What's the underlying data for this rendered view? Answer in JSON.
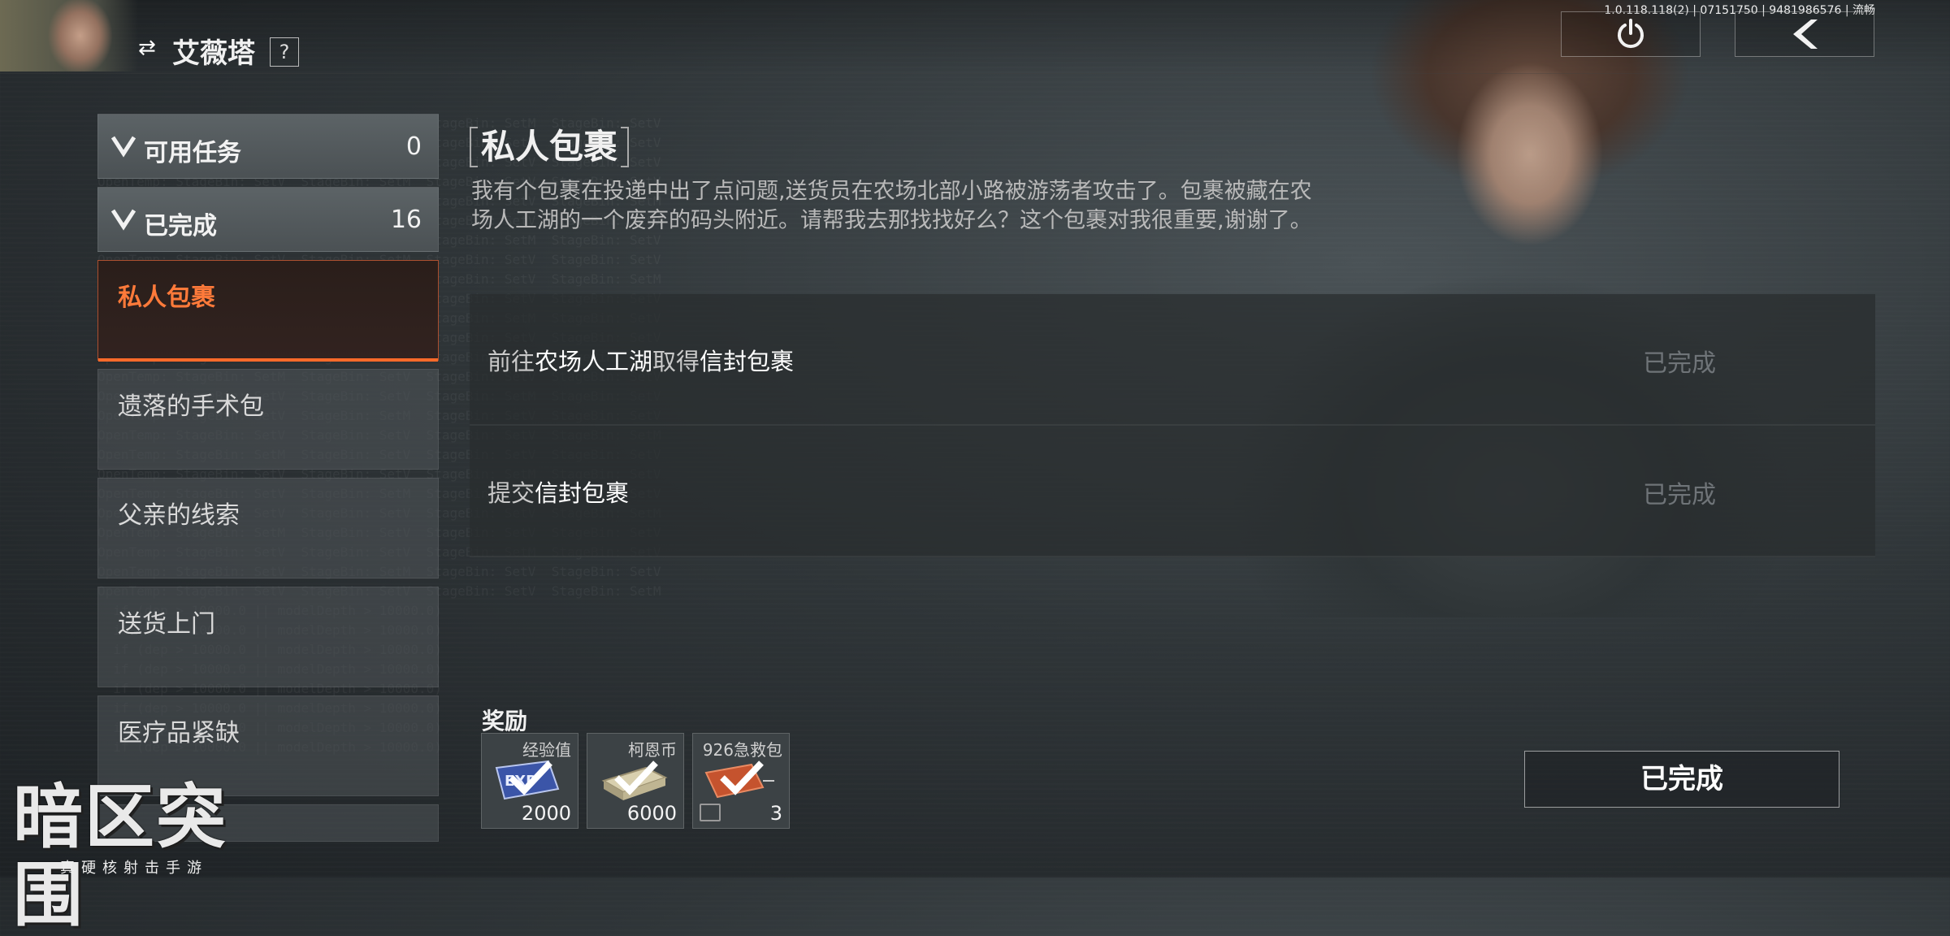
{
  "header": {
    "character_name": "艾薇塔",
    "help_label": "?",
    "version_info": "1.0.118.118(2) | 07151750 | 9481986576 | 流畅",
    "swap_icon": "swap-icon",
    "power_icon": "power-icon",
    "back_icon": "back-icon"
  },
  "sidebar": {
    "categories": [
      {
        "label": "可用任务",
        "count": "0"
      },
      {
        "label": "已完成",
        "count": "16"
      }
    ],
    "quests": [
      {
        "label": "私人包裹",
        "active": true
      },
      {
        "label": "遗落的手术包"
      },
      {
        "label": "父亲的线索"
      },
      {
        "label": "送货上门"
      },
      {
        "label": "医疗品紧缺"
      }
    ]
  },
  "quest": {
    "title": "私人包裹",
    "description": "我有个包裹在投递中出了点问题,送货员在农场北部小路被游荡者攻击了。包裹被藏在农场人工湖的一个废弃的码头附近。请帮我去那找找好么？这个包裹对我很重要,谢谢了。",
    "objectives": [
      {
        "parts": [
          "前往",
          "农场人工湖",
          "取得",
          "信封包裹"
        ],
        "state": "已完成"
      },
      {
        "parts": [
          "提交",
          "信封包裹"
        ],
        "state": "已完成"
      }
    ]
  },
  "rewards": {
    "title": "奖励",
    "items": [
      {
        "name": "经验值",
        "count": "2000"
      },
      {
        "name": "柯恩币",
        "count": "6000"
      },
      {
        "name": "926急救包",
        "count": "3"
      }
    ]
  },
  "complete_button": "已完成",
  "logo": {
    "main": "暗区突围",
    "sub": "真硬核射击手游"
  },
  "colors": {
    "accent": "#ff6a2a",
    "panel": "#4b5154"
  }
}
